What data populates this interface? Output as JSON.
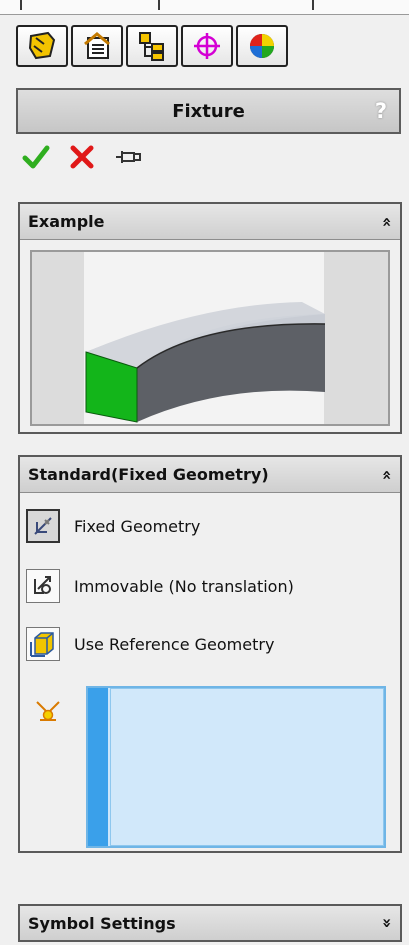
{
  "toolbar": {
    "tabs": [
      {
        "icon": "feature-manager-icon"
      },
      {
        "icon": "property-manager-icon"
      },
      {
        "icon": "configuration-manager-icon"
      },
      {
        "icon": "dimxpert-icon"
      },
      {
        "icon": "display-manager-icon"
      }
    ]
  },
  "header": {
    "title": "Fixture",
    "help": "?"
  },
  "actions": {
    "ok_icon": "green-check-icon",
    "cancel_icon": "red-x-icon",
    "pin_icon": "pushpin-icon"
  },
  "example": {
    "title": "Example",
    "chevron": "≈"
  },
  "standard": {
    "title": "Standard(Fixed Geometry)",
    "chevron": "≈",
    "options": [
      {
        "label": "Fixed Geometry",
        "icon": "fixed-geometry-icon",
        "selected": true
      },
      {
        "label": "Immovable (No translation)",
        "icon": "immovable-icon",
        "selected": false
      },
      {
        "label": "Use Reference Geometry",
        "icon": "reference-geometry-icon",
        "selected": false
      }
    ],
    "selection_icon": "vertex-icon"
  },
  "symbol": {
    "title": "Symbol Settings",
    "chevron": "≈"
  },
  "colors": {
    "accent_blue": "#3aa0ea",
    "selection_fill": "#cce6fb",
    "green_face": "#13b51a",
    "gray_face": "#5d6066"
  }
}
